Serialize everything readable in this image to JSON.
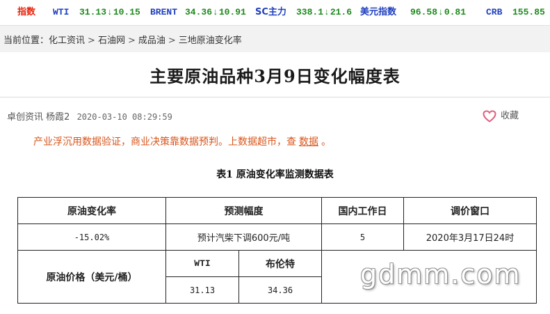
{
  "ticker": {
    "index_label": "指数",
    "wti": {
      "name": "WTI",
      "value": "31.13",
      "change": "10.15"
    },
    "brent": {
      "name": "BRENT",
      "value": "34.36",
      "change": "10.91"
    },
    "sc": {
      "name": "SC主力",
      "value": "338.1",
      "change": "21.6"
    },
    "usd": {
      "name": "美元指数",
      "value": "96.58",
      "change": "0.81"
    },
    "crb": {
      "name": "CRB",
      "value": "155.85"
    },
    "down_arrow": "↓",
    "colors": {
      "label": "#e8230a",
      "name": "#1f3fbf",
      "value": "#1c8a1c"
    }
  },
  "breadcrumb": {
    "prefix": "当前位置：",
    "items": [
      "化工资讯",
      "石油网",
      "成品油",
      "三地原油变化率"
    ],
    "separator": ">"
  },
  "article": {
    "title": "主要原油品种3月9日变化幅度表",
    "source": "卓创资讯",
    "author": "杨霞2",
    "datetime": "2020-03-10 08:29:59",
    "favorite_label": "收藏",
    "favorite_icon": "heart-icon",
    "notice_before": "产业浮沉用数据验证，商业决策靠数据预判。上数据超市，查",
    "notice_link": "数据",
    "notice_after": "。"
  },
  "table": {
    "caption": "表1   原油变化率监测数据表",
    "headers": [
      "原油变化率",
      "预测幅度",
      "国内工作日",
      "调价窗口"
    ],
    "row1": [
      "-15.02%",
      "预计汽柴下调600元/吨",
      "5",
      "2020年3月17日24时"
    ],
    "price_label": "原油价格（美元/桶）",
    "price_headers": [
      "WTI",
      "布伦特"
    ],
    "price_values": [
      "31.13",
      "34.36"
    ]
  },
  "watermark": "gdmm.com"
}
